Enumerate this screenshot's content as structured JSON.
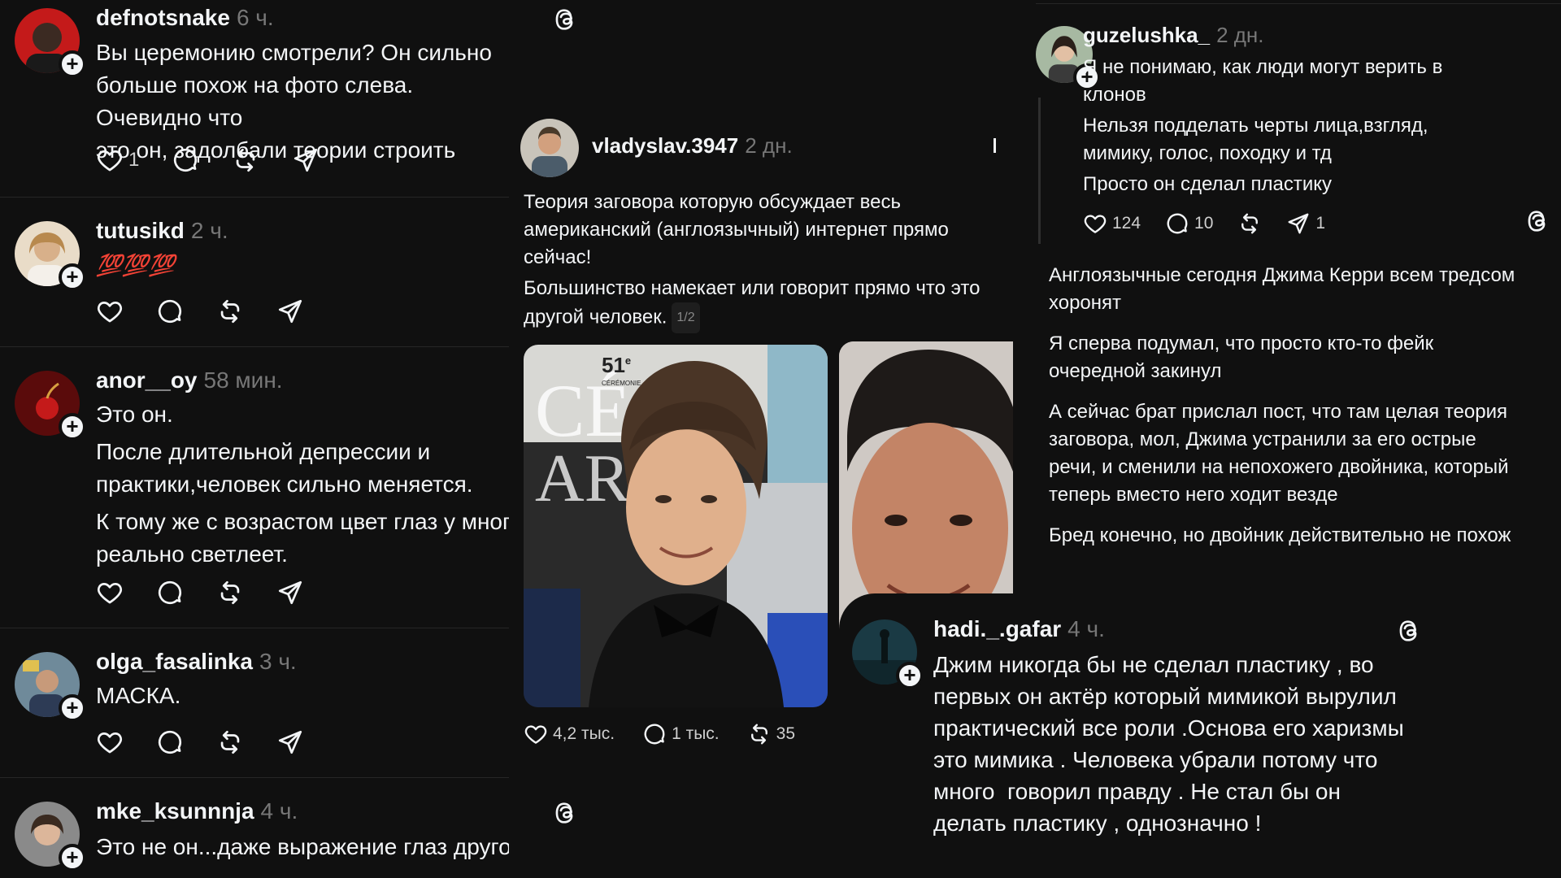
{
  "left": {
    "posts": [
      {
        "username": "defnotsnake",
        "time": "6 ч.",
        "lines": [
          "Вы церемонию смотрели? Он сильно",
          "больше похож на фото слева. Очевидно что",
          "это он, задолбали теории строить"
        ],
        "likes": "1"
      },
      {
        "username": "tutusikd",
        "time": "2 ч.",
        "emoji": "💯💯💯"
      },
      {
        "username": "anor__oy",
        "time": "58 мин.",
        "lines": [
          "Это он."
        ],
        "lines2": [
          "После длительной депрессии и",
          "практики,человек сильно меняется."
        ],
        "lines3": [
          "К тому же с возрастом цвет глаз у многих",
          "реально светлеет."
        ]
      },
      {
        "username": "olga_fasalinka",
        "time": "3 ч.",
        "lines": [
          "МАСКА."
        ]
      },
      {
        "username": "mke_ksunnnja",
        "time": "4 ч.",
        "lines": [
          "Это не он...даже выражение глаз другое....."
        ]
      }
    ]
  },
  "middle": {
    "username": "vladyslav.3947",
    "time": "2 дн.",
    "para1": [
      "Теория заговора которую обсуждает весь",
      "американский (англоязычный) интернет прямо",
      "сейчас!"
    ],
    "para2_line1": "Большинство намекает или говорит прямо что это",
    "para2_line2": "другой человек.",
    "page_badge": "1/2",
    "photo_sign_number": "51",
    "photo_sign_sup": "e",
    "photo_sign_word": "CÉRÉMONIE",
    "likes": "4,2 тыс.",
    "comments": "1 тыс.",
    "reposts": "35"
  },
  "right_top": {
    "username": "guzelushka_",
    "time": "2 дн.",
    "lines": [
      "Я не понимаю, как люди могут верить в",
      "клонов"
    ],
    "lines2": [
      "Нельзя подделать черты лица,взгляд,",
      "мимику, голос, походку и тд"
    ],
    "lines3": [
      "Просто он сделал пластику"
    ],
    "likes": "124",
    "comments": "10",
    "shares": "1"
  },
  "right_text": {
    "paragraphs": [
      [
        "Англоязычные сегодня Джима Керри всем тредсом",
        "хоронят"
      ],
      [
        "Я сперва подумал, что просто кто-то фейк",
        "очередной закинул"
      ],
      [
        "А сейчас брат прислал пост, что там целая теория",
        "заговора, мол, Джима устранили за его острые",
        "речи, и сменили на непохожего двойника, который",
        "теперь вместо него ходит везде"
      ],
      [
        "Бред конечно, но двойник действительно не похож"
      ]
    ]
  },
  "bottom_right": {
    "username": "hadi._.gafar",
    "time": "4 ч.",
    "lines": [
      "Джим никогда бы не сделал пластику , во",
      "первых он актёр который мимикой вырулил",
      "практический все роли .Основа его харизмы",
      "это мимика . Человека убрали потому что",
      "много  говорил правду . Не стал бы он",
      "делать пластику , однозначно !"
    ]
  },
  "icons": {
    "like": "heart-icon",
    "comment": "comment-bubble-icon",
    "repost": "repost-icon",
    "share": "share-paper-plane-icon",
    "threads": "threads-logo-icon",
    "follow": "plus-icon"
  },
  "colors": {
    "background": "#101010",
    "text": "#f3f5f7",
    "muted": "#777777",
    "divider": "#262626"
  }
}
